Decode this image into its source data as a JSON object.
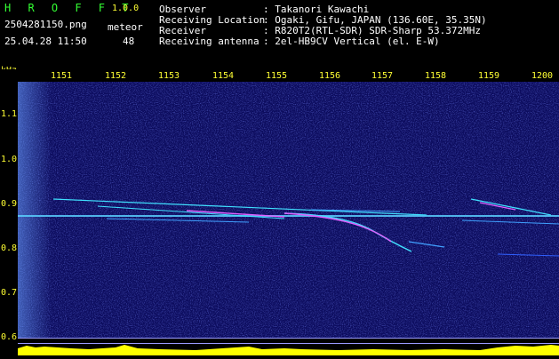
{
  "app": {
    "name": "H R O F F T",
    "version": "1.0.0",
    "filename": "2504281150.png",
    "datetime": "25.04.28 11:50",
    "meteor_label": "meteor",
    "meteor_count": "48"
  },
  "station": {
    "rows": [
      {
        "key": "Observer",
        "value": ": Takanori Kawachi"
      },
      {
        "key": "Receiving Location",
        "value": ": Ogaki, Gifu, JAPAN (136.60E, 35.35N)"
      },
      {
        "key": "Receiver",
        "value": ": R820T2(RTL-SDR) SDR-Sharp 53.372MHz"
      },
      {
        "key": "Receiving antenna",
        "value": ": 2el-HB9CV Vertical (el. E-W)"
      }
    ]
  },
  "axes": {
    "y_unit": "kHz",
    "x_ticks": [
      "1151",
      "1152",
      "1153",
      "1154",
      "1155",
      "1156",
      "1157",
      "1158",
      "1159",
      "1200"
    ],
    "y_ticks": [
      "1.1",
      "1.0",
      "0.9",
      "0.8",
      "0.7",
      "0.6"
    ]
  },
  "colors": {
    "background": "#0c0c5e",
    "label": "#ffff33",
    "brand": "#33ff33",
    "text": "#ffffff",
    "carrier": "#5ad0ff",
    "meteor": "#e060ff",
    "level": "#ffff00"
  }
}
